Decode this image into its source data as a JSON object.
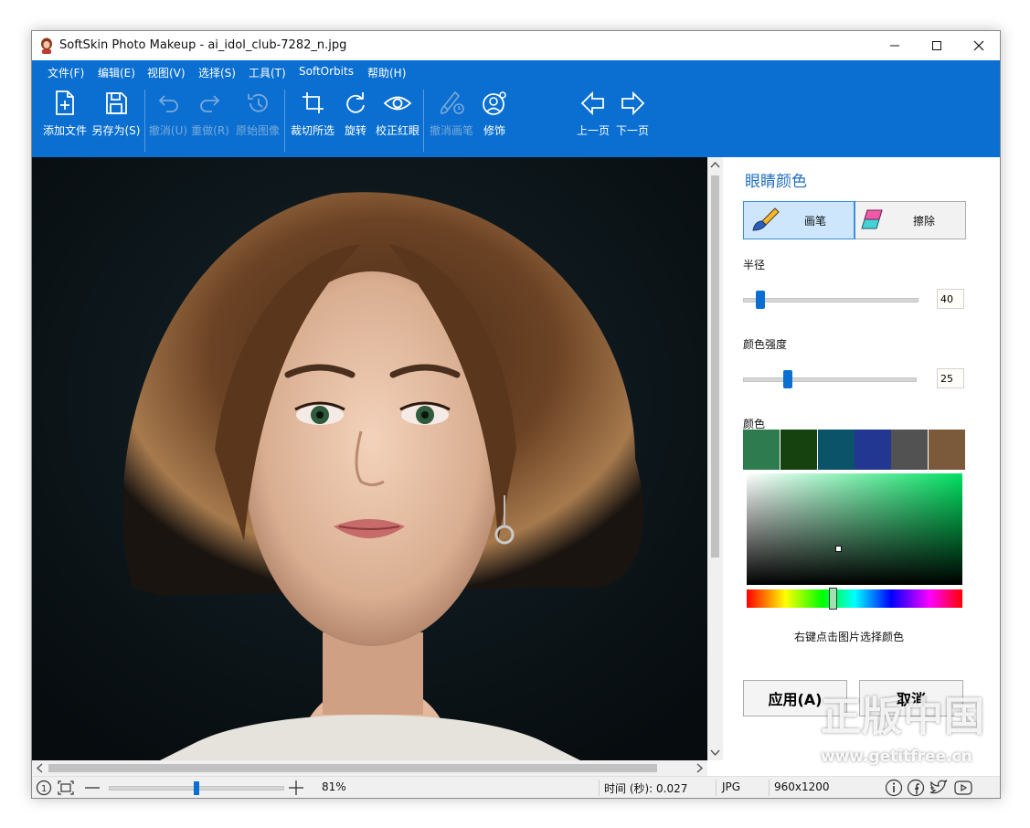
{
  "window": {
    "title": "SoftSkin Photo Makeup - ai_idol_club-7282_n.jpg"
  },
  "menu": [
    "文件(F)",
    "编辑(E)",
    "视图(V)",
    "选择(S)",
    "工具(T)",
    "SoftOrbits",
    "帮助(H)"
  ],
  "toolbar": {
    "add_file": "添加文件",
    "save_as": "另存为(S)",
    "undo": "撤消(U)",
    "redo": "重做(R)",
    "original": "原始图像",
    "crop": "裁切所选",
    "rotate": "旋转",
    "redeye": "校正红眼",
    "undo_brush": "撤消画笔",
    "retouch": "修饰",
    "prev": "上一页",
    "next": "下一页"
  },
  "panel": {
    "title": "眼睛颜色",
    "brush_label": "画笔",
    "erase_label": "擦除",
    "radius_label": "半径",
    "radius_value": "40",
    "strength_label": "颜色强度",
    "strength_value": "25",
    "color_label": "颜色",
    "swatches": [
      "#2f7b50",
      "#15420f",
      "#0a5368",
      "#223791",
      "#525252",
      "#7a5a3a"
    ],
    "picker_hue": "#00e060",
    "hint": "右键点击图片选择颜色",
    "apply": "应用(A)",
    "cancel": "取消"
  },
  "status": {
    "zoom": "81%",
    "zoom_level": 0.5,
    "time": "时间 (秒): 0.027",
    "format": "JPG",
    "size": "960x1200"
  },
  "watermark": {
    "big": "正版中国",
    "small": "www.getitfree.cn"
  }
}
